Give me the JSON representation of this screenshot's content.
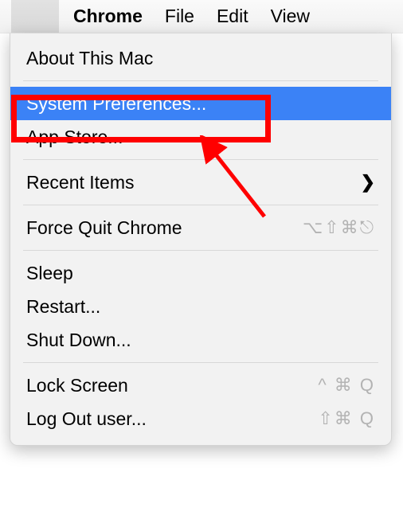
{
  "menubar": {
    "app_name": "Chrome",
    "items": [
      "File",
      "Edit",
      "View"
    ]
  },
  "dropdown": {
    "about": "About This Mac",
    "system_preferences": "System Preferences...",
    "app_store": "App Store...",
    "recent_items": "Recent Items",
    "force_quit": "Force Quit Chrome",
    "force_quit_shortcut": "⌥⇧⌘⎋",
    "sleep": "Sleep",
    "restart": "Restart...",
    "shutdown": "Shut Down...",
    "lock_screen": "Lock Screen",
    "lock_screen_shortcut": "^ ⌘ Q",
    "log_out": "Log Out user...",
    "log_out_shortcut": "⇧⌘ Q"
  }
}
